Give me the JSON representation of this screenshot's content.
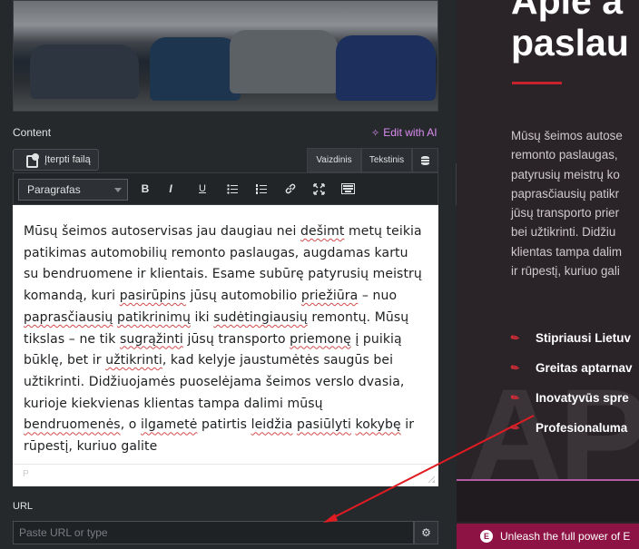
{
  "panel": {
    "section_label": "Content",
    "edit_ai_label": "Edit with AI",
    "media_button_label": "Įterpti failą",
    "tabs": [
      "Vaizdinis",
      "Tekstinis"
    ],
    "format_select_value": "Paragrafas",
    "toolbar_icons": [
      "bold-icon",
      "italic-icon",
      "underline-icon",
      "bullet-list-icon",
      "numbered-list-icon",
      "link-icon",
      "fullscreen-icon",
      "keyboard-icon"
    ],
    "editor_footer_path": "P",
    "url_label": "URL",
    "url_placeholder": "Paste URL or type"
  },
  "editor": {
    "paragraph": [
      {
        "t": "Mūsų šeimos autoservisas jau daugiau nei "
      },
      {
        "t": "dešimt",
        "s": true
      },
      {
        "t": " metų teikia patikimas automobilių remonto paslaugas, augdamas kartu su bendruomene ir klientais. Esame subūrę patyrusių meistrų komandą, kuri "
      },
      {
        "t": "pasirūpins",
        "s": true
      },
      {
        "t": " jūsų automobilio "
      },
      {
        "t": "priežiūra",
        "s": true
      },
      {
        "t": " – nuo "
      },
      {
        "t": "paprasčiausių",
        "s": true
      },
      {
        "t": " "
      },
      {
        "t": "patikrinimų",
        "s": true
      },
      {
        "t": " iki "
      },
      {
        "t": "sudėtingiausių",
        "s": true
      },
      {
        "t": " remontų. Mūsų tikslas – ne tik "
      },
      {
        "t": "sugrąžinti",
        "s": true
      },
      {
        "t": " jūsų transporto "
      },
      {
        "t": "priemonę",
        "s": true
      },
      {
        "t": " į puikią būklę, bet ir "
      },
      {
        "t": "užtikrinti",
        "s": true
      },
      {
        "t": ", kad kelyje jaustumėtės saugūs bei užtikrinti. Didžiuojamės puoselėjama šeimos verslo dvasia, kurioje kiekvienas klientas tampa dalimi mūsų "
      },
      {
        "t": "bendruomenės",
        "s": true
      },
      {
        "t": ", o "
      },
      {
        "t": "ilgametė",
        "s": true
      },
      {
        "t": " patirtis "
      },
      {
        "t": "leidžia",
        "s": true
      },
      {
        "t": " "
      },
      {
        "t": "pasiūlyti",
        "s": true
      },
      {
        "t": " "
      },
      {
        "t": "kokybę",
        "s": true
      },
      {
        "t": " ir rūpestį, kuriuo galite"
      }
    ]
  },
  "preview": {
    "title_line1": "Apie a",
    "title_line2": "paslau",
    "body_lines": [
      "Mūsų šeimos autose",
      "remonto paslaugas,",
      "patyrusių meistrų ko",
      "paprasčiausių patikr",
      "jūsų transporto prier",
      "bei užtikrinti. Didžiu",
      "klientas tampa dalim",
      "ir rūpestį, kuriuo gali"
    ],
    "features": [
      "Stipriausi Lietuv",
      "Greitas aptarnav",
      "Inovatyvūs spre",
      "Profesionaluma"
    ],
    "promo_text": "Unleash the full power of E",
    "accent_color": "#c9222f",
    "promo_color": "#8c1344"
  }
}
